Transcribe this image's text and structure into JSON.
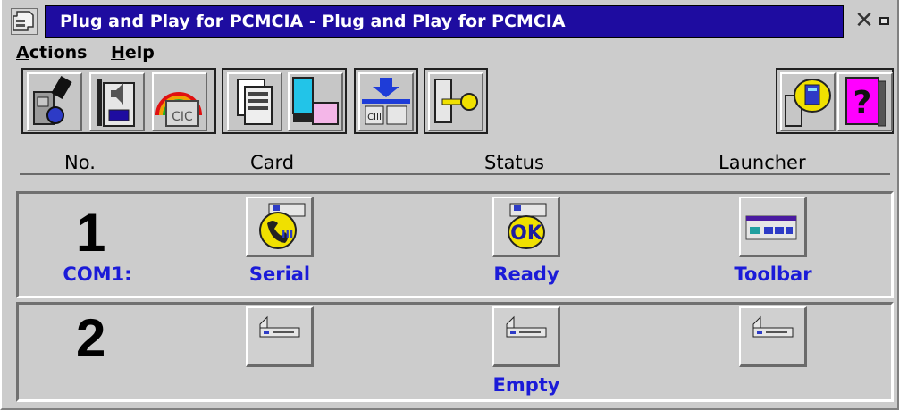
{
  "window": {
    "title": "Plug and Play for PCMCIA - Plug and Play for PCMCIA",
    "close_glyph": "✕"
  },
  "menu": {
    "actions_first": "A",
    "actions_rest": "ctions",
    "help_first": "H",
    "help_rest": "elp"
  },
  "toolbar": {
    "icons": [
      "socket-card-icon",
      "audio-device-icon",
      "rainbow-display-icon",
      "documents-icon",
      "computer-icon",
      "install-icon",
      "key-icon",
      "calculator-chat-icon",
      "help-book-icon"
    ]
  },
  "columns": {
    "no": "No.",
    "card": "Card",
    "status": "Status",
    "launcher": "Launcher"
  },
  "slots": [
    {
      "number": "1",
      "port": "COM1:",
      "card_label": "Serial",
      "status_label": "Ready",
      "launcher_label": "Toolbar",
      "status_text_icon": "OK"
    },
    {
      "number": "2",
      "port": "",
      "card_label": "",
      "status_label": "Empty",
      "launcher_label": ""
    }
  ],
  "colors": {
    "title_bar": "#1e0ca0",
    "label_blue": "#1b1bd8",
    "window_face": "#cccccc"
  }
}
